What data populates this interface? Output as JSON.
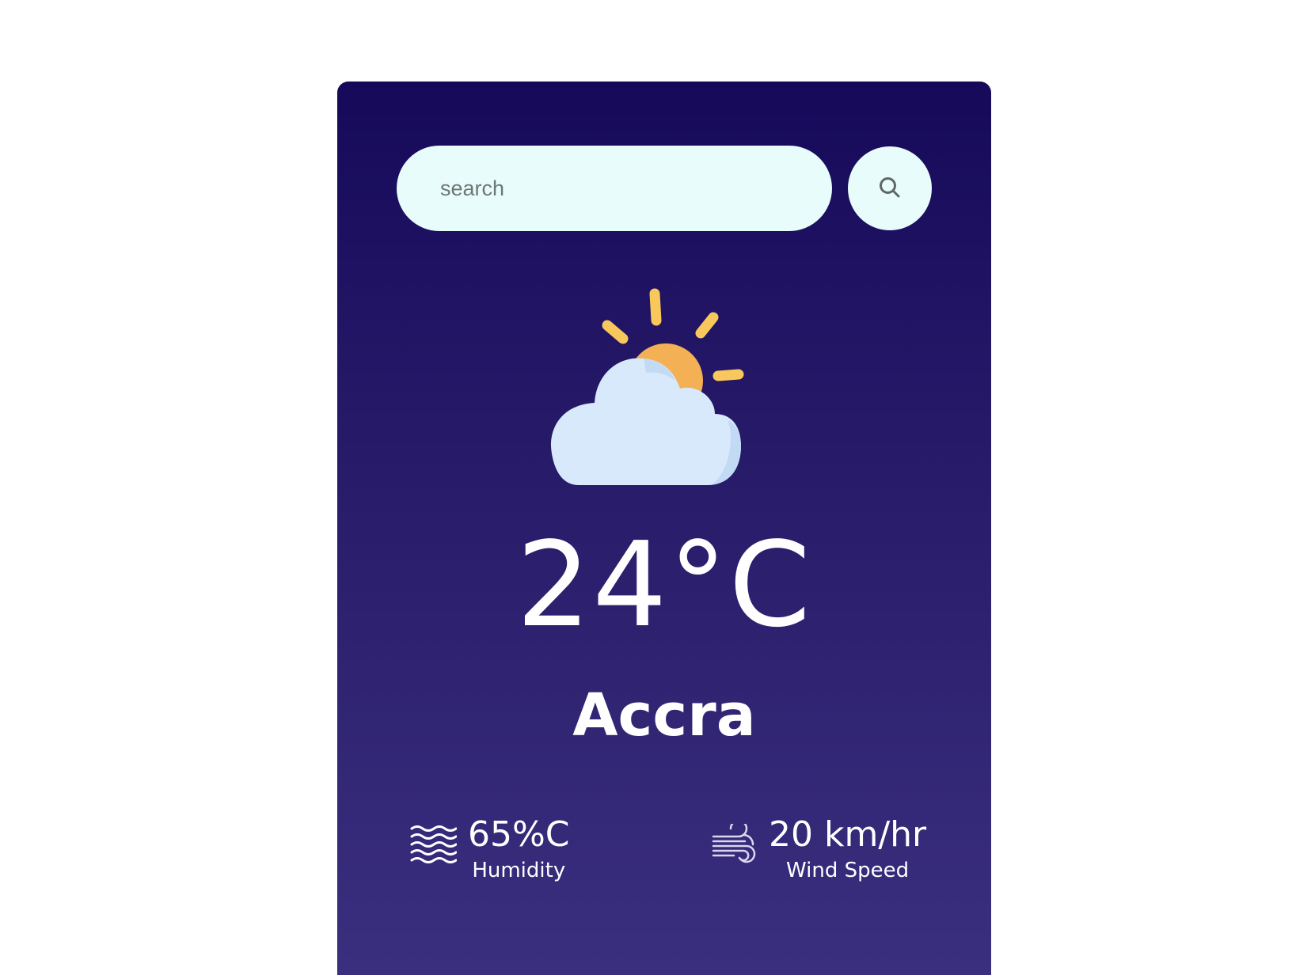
{
  "search": {
    "placeholder": "search",
    "value": ""
  },
  "weather": {
    "icon": "partly-cloudy-icon",
    "temperature": "24°C",
    "city": "Accra"
  },
  "stats": {
    "humidity": {
      "icon": "humidity-waves-icon",
      "value": "65%C",
      "label": "Humidity"
    },
    "wind": {
      "icon": "wind-icon",
      "value": "20 km/hr",
      "label": "Wind Speed"
    }
  },
  "colors": {
    "card_top": "#16095a",
    "card_bottom": "#3a2f7e",
    "search_bg": "#e8fdfb",
    "sun": "#f4b054",
    "sun_rays": "#f8c85c",
    "cloud": "#d8e9fb",
    "text": "#ffffff"
  }
}
